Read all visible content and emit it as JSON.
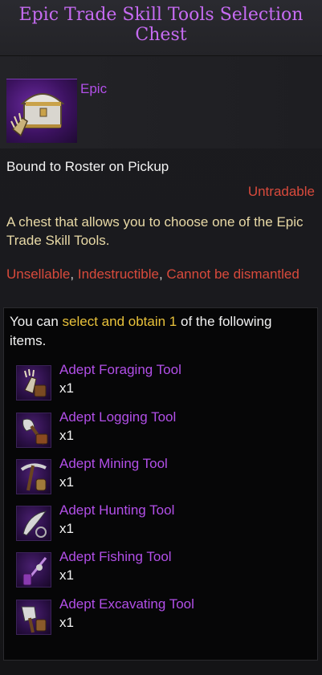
{
  "tooltip": {
    "title": "Epic Trade Skill Tools Selection Chest",
    "grade": "Epic",
    "bound": "Bound to Roster on Pickup",
    "tradable": "Untradable",
    "description": "A chest that allows you to choose one of the Epic Trade Skill Tools.",
    "restrictions": {
      "r1": "Unsellable",
      "r2": "Indestructible",
      "r3": "Cannot be dismantled",
      "separator": ", "
    },
    "choice": {
      "pre": "You can ",
      "highlight": "select and obtain 1",
      "post": " of the following items."
    },
    "options": [
      {
        "name": "Adept Foraging Tool",
        "qty": "x1",
        "icon": "foraging-tool-icon"
      },
      {
        "name": "Adept Logging Tool",
        "qty": "x1",
        "icon": "logging-tool-icon"
      },
      {
        "name": "Adept Mining Tool",
        "qty": "x1",
        "icon": "mining-tool-icon"
      },
      {
        "name": "Adept Hunting Tool",
        "qty": "x1",
        "icon": "hunting-tool-icon"
      },
      {
        "name": "Adept Fishing Tool",
        "qty": "x1",
        "icon": "fishing-tool-icon"
      },
      {
        "name": "Adept Excavating Tool",
        "qty": "x1",
        "icon": "excavating-tool-icon"
      }
    ],
    "colors": {
      "epic": "#b24fe8",
      "restriction": "#d94a3c",
      "description": "#e8d9a6",
      "highlight": "#e9c23b"
    }
  }
}
